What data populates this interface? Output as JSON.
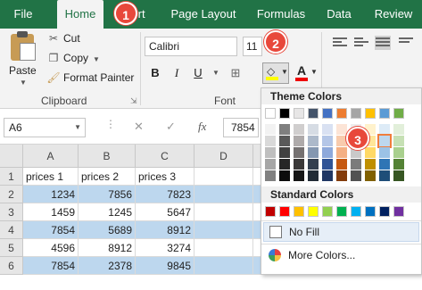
{
  "ribbon": {
    "tabs": [
      {
        "label": "File",
        "active": false
      },
      {
        "label": "Home",
        "active": true
      },
      {
        "label": "Insert",
        "active": false,
        "shown": "ert"
      },
      {
        "label": "Page Layout",
        "active": false
      },
      {
        "label": "Formulas",
        "active": false
      },
      {
        "label": "Data",
        "active": false
      },
      {
        "label": "Review",
        "active": false
      }
    ],
    "clipboard": {
      "paste": "Paste",
      "cut": "Cut",
      "copy": "Copy",
      "format_painter": "Format Painter",
      "label": "Clipboard"
    },
    "font": {
      "name": "Calibri",
      "size": "11",
      "bold": "B",
      "italic": "I",
      "underline": "U",
      "font_color_glyph": "A",
      "label": "Font",
      "fill_color": "#ffff00",
      "text_color": "#e00000"
    }
  },
  "formula_bar": {
    "name_box": "A6",
    "cancel_glyph": "✕",
    "enter_glyph": "✓",
    "fx_glyph": "fx",
    "value": "7854"
  },
  "sheet": {
    "columns": [
      "A",
      "B",
      "C",
      "D"
    ],
    "rows": [
      {
        "num": "1",
        "cells": [
          "prices 1",
          "prices 2",
          "prices 3",
          ""
        ],
        "banded": false
      },
      {
        "num": "2",
        "cells": [
          "1234",
          "7856",
          "7823",
          ""
        ],
        "banded": true
      },
      {
        "num": "3",
        "cells": [
          "1459",
          "1245",
          "5647",
          ""
        ],
        "banded": false
      },
      {
        "num": "4",
        "cells": [
          "7854",
          "5689",
          "8912",
          ""
        ],
        "banded": true
      },
      {
        "num": "5",
        "cells": [
          "4596",
          "8912",
          "3274",
          ""
        ],
        "banded": false
      },
      {
        "num": "6",
        "cells": [
          "7854",
          "2378",
          "9845",
          ""
        ],
        "banded": true
      }
    ],
    "band_color": "#bdd7ee"
  },
  "fill_dropdown": {
    "theme_header": "Theme Colors",
    "standard_header": "Standard Colors",
    "no_fill": "No Fill",
    "more_colors": "More Colors...",
    "theme_top": [
      "#ffffff",
      "#000000",
      "#e7e6e6",
      "#44546a",
      "#4472c4",
      "#ed7d31",
      "#a5a5a5",
      "#ffc000",
      "#5b9bd5",
      "#70ad47"
    ],
    "theme_shades": [
      [
        "#f2f2f2",
        "#7f7f7f",
        "#d0cece",
        "#d6dce4",
        "#d9e1f2",
        "#fce4d6",
        "#ededed",
        "#fff2cc",
        "#ddebf7",
        "#e2efda"
      ],
      [
        "#d9d9d9",
        "#595959",
        "#aeaaaa",
        "#acb9ca",
        "#b4c6e7",
        "#f8cbad",
        "#dbdbdb",
        "#ffe699",
        "#bdd7ee",
        "#c6e0b4"
      ],
      [
        "#bfbfbf",
        "#404040",
        "#757171",
        "#8497b0",
        "#8ea9db",
        "#f4b084",
        "#c9c9c9",
        "#ffd966",
        "#9bc2e6",
        "#a9d08e"
      ],
      [
        "#a6a6a6",
        "#262626",
        "#3a3838",
        "#333f4f",
        "#305496",
        "#c65911",
        "#7b7b7b",
        "#bf8f00",
        "#2f75b5",
        "#548235"
      ],
      [
        "#808080",
        "#0d0d0d",
        "#161616",
        "#222b35",
        "#203764",
        "#833c0c",
        "#525252",
        "#806000",
        "#1f4e78",
        "#375623"
      ]
    ],
    "standard": [
      "#c00000",
      "#ff0000",
      "#ffc000",
      "#ffff00",
      "#92d050",
      "#00b050",
      "#00b0f0",
      "#0070c0",
      "#002060",
      "#7030a0"
    ],
    "highlighted": {
      "row": 1,
      "col": 8
    }
  },
  "callouts": [
    "1",
    "2",
    "3"
  ],
  "accent_color": "#217346",
  "callout_color": "#e8483b"
}
